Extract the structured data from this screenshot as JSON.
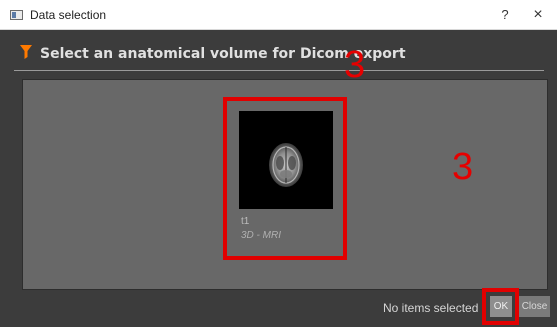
{
  "window": {
    "title": "Data selection",
    "help_label": "?",
    "close_label": "×"
  },
  "header": {
    "title": "Select an anatomical volume for Dicom export",
    "icon": "filter-icon",
    "accent_color": "#ff7a00"
  },
  "volume": {
    "name": "t1",
    "type": "3D - MRI"
  },
  "annotations": {
    "step_label_card": "3",
    "step_label_ok": "3",
    "highlight_color": "#e10000"
  },
  "footer": {
    "status": "No items selected",
    "ok_label": "OK",
    "close_label": "Close"
  }
}
